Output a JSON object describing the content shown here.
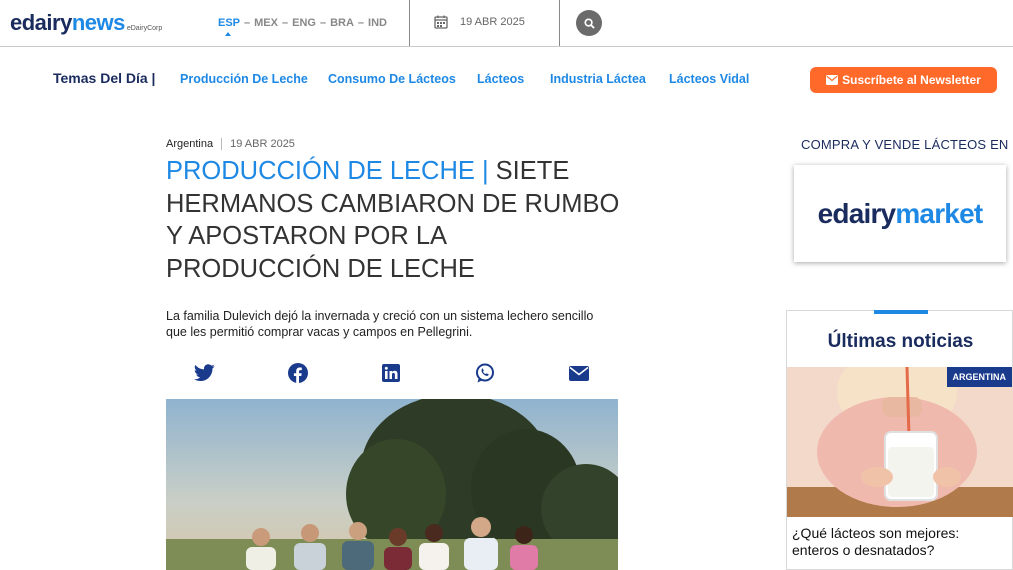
{
  "header": {
    "logo_main_1": "edairy",
    "logo_main_2": "news",
    "logo_sub": "eDairyCorp",
    "languages": [
      "ESP",
      "MEX",
      "ENG",
      "BRA",
      "IND"
    ],
    "date": "19 ABR 2025"
  },
  "nav": {
    "label": "Temas Del Día |",
    "items": [
      "Producción De Leche",
      "Consumo De Lácteos",
      "Lácteos",
      "Industria Láctea",
      "Lácteos Vidal"
    ],
    "newsletter": "Suscríbete al Newsletter"
  },
  "article": {
    "country": "Argentina",
    "date": "19 ABR 2025",
    "category": "PRODUCCIÓN DE LECHE |",
    "title": " SIETE HERMANOS CAMBIARON DE RUMBO Y APOSTARON POR LA PRODUCCIÓN DE LECHE",
    "lead": "La familia Dulevich dejó la invernada y creció con un sistema lechero sencillo que les permitió comprar vacas y campos en Pellegrini.",
    "share_icons": [
      "twitter-icon",
      "facebook-icon",
      "linkedin-icon",
      "whatsapp-icon",
      "email-icon"
    ]
  },
  "sidebar": {
    "market_label": "COMPRA Y VENDE LÁCTEOS EN",
    "market_logo_1": "edairy",
    "market_logo_2": "market",
    "news_title": "Últimas noticias",
    "news_badge": "ARGENTINA",
    "news_headline": "¿Qué lácteos son mejores: enteros o desnatados?"
  },
  "colors": {
    "brand_dark": "#1a2b5e",
    "brand_blue": "#1e88e5",
    "newsletter_orange": "#ff6a2a"
  }
}
